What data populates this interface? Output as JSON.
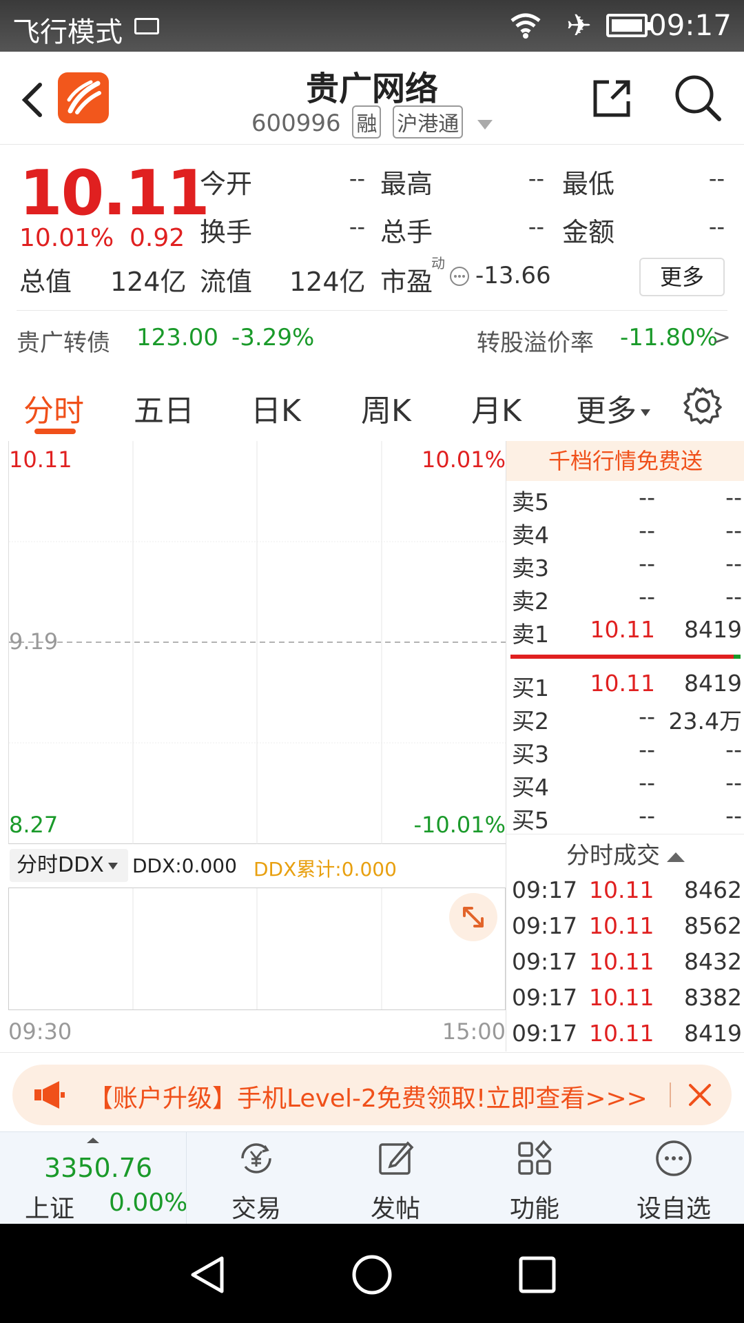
{
  "status_bar": {
    "mode": "飞行模式",
    "time": "09:17"
  },
  "header": {
    "stock_name": "贵广网络",
    "stock_code": "600996",
    "tags": [
      "融",
      "沪港通"
    ]
  },
  "quote": {
    "price": "10.11",
    "change_pct": "10.01%",
    "change": "0.92",
    "fields": [
      {
        "label": "今开",
        "value": "--"
      },
      {
        "label": "最高",
        "value": "--"
      },
      {
        "label": "最低",
        "value": "--"
      },
      {
        "label": "换手",
        "value": "--"
      },
      {
        "label": "总手",
        "value": "--"
      },
      {
        "label": "金额",
        "value": "--"
      }
    ],
    "total_value_label": "总值",
    "total_value": "124亿",
    "float_value_label": "流值",
    "float_value": "124亿",
    "pe_label": "市盈",
    "pe_super": "动",
    "pe_value": "-13.66",
    "more_label": "更多"
  },
  "bond": {
    "label": "贵广转债",
    "price": "123.00",
    "pct": "-3.29%",
    "premium_label": "转股溢价率",
    "premium_value": "-11.80%",
    "arrow": ">"
  },
  "tabs": [
    "分时",
    "五日",
    "日K",
    "周K",
    "月K",
    "更多"
  ],
  "chart": {
    "top_price": "10.11",
    "top_pct": "10.01%",
    "mid_price": "9.19",
    "bottom_price": "8.27",
    "bottom_pct": "-10.01%",
    "time_start": "09:30",
    "time_end": "15:00"
  },
  "ddx": {
    "select_label": "分时DDX",
    "ddx_value": "DDX:0.000",
    "ddx_cum": "DDX累计:0.000"
  },
  "order_book": {
    "promo": "千档行情免费送",
    "asks": [
      {
        "label": "卖5",
        "price": "--",
        "vol": "--"
      },
      {
        "label": "卖4",
        "price": "--",
        "vol": "--"
      },
      {
        "label": "卖3",
        "price": "--",
        "vol": "--"
      },
      {
        "label": "卖2",
        "price": "--",
        "vol": "--"
      },
      {
        "label": "卖1",
        "price": "10.11",
        "vol": "8419"
      }
    ],
    "bids": [
      {
        "label": "买1",
        "price": "10.11",
        "vol": "8419"
      },
      {
        "label": "买2",
        "price": "--",
        "vol": "23.4万"
      },
      {
        "label": "买3",
        "price": "--",
        "vol": "--"
      },
      {
        "label": "买4",
        "price": "--",
        "vol": "--"
      },
      {
        "label": "买5",
        "price": "--",
        "vol": "--"
      }
    ],
    "trades_title": "分时成交",
    "trades": [
      {
        "time": "09:17",
        "price": "10.11",
        "vol": "8462"
      },
      {
        "time": "09:17",
        "price": "10.11",
        "vol": "8562"
      },
      {
        "time": "09:17",
        "price": "10.11",
        "vol": "8432"
      },
      {
        "time": "09:17",
        "price": "10.11",
        "vol": "8382"
      },
      {
        "time": "09:17",
        "price": "10.11",
        "vol": "8419"
      }
    ]
  },
  "banner": {
    "text": "【账户升级】手机Level-2免费领取!立即查看>>>"
  },
  "bottom_nav": {
    "index_value": "3350.76",
    "index_name": "上证",
    "index_pct": "0.00%",
    "items": [
      "交易",
      "发帖",
      "功能",
      "设自选"
    ]
  },
  "colors": {
    "up": "#e02020",
    "down": "#1a9a2a",
    "accent": "#f0501a"
  }
}
